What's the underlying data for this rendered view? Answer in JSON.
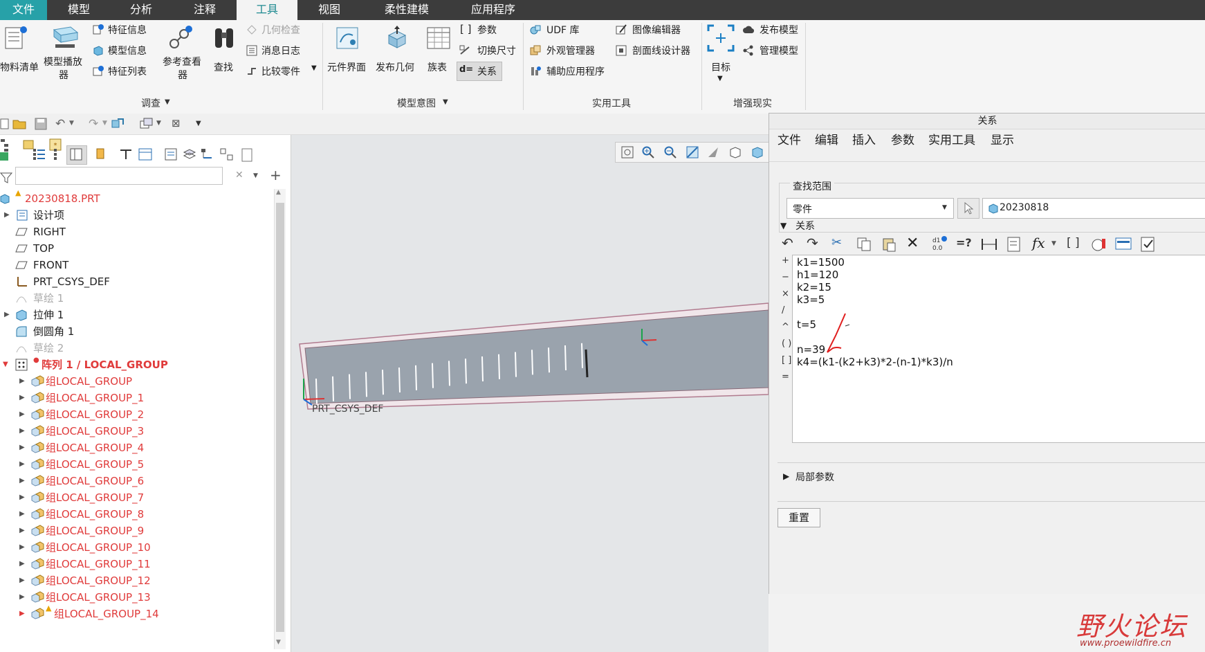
{
  "tabs": [
    "文件",
    "模型",
    "分析",
    "注释",
    "工具",
    "视图",
    "柔性建模",
    "应用程序"
  ],
  "active_tab": "工具",
  "ribbon": {
    "investigate": {
      "bom_label": "物料清单",
      "model_player_label1": "模型播放",
      "model_player_label2": "器",
      "feature_info": "特征信息",
      "model_info": "模型信息",
      "feature_list": "特征列表",
      "ref_viewer1": "参考查看",
      "ref_viewer2": "器",
      "find_label": "查找",
      "geom_check": "几何检查",
      "message_log": "消息日志",
      "compare_parts": "比较零件",
      "group_label": "调查"
    },
    "model_intent": {
      "component_interface": "元件界面",
      "publish_geom": "发布几何",
      "family_table": "族表",
      "parameters": "参数",
      "switch_dims": "切换尺寸",
      "relations": "关系",
      "group_label": "模型意图"
    },
    "utilities": {
      "udf_lib": "UDF 库",
      "appearance_mgr": "外观管理器",
      "aux_apps": "辅助应用程序",
      "image_editor": "图像编辑器",
      "section_designer": "剖面线设计器",
      "group_label": "实用工具"
    },
    "ar": {
      "targets": "目标",
      "publish_model": "发布模型",
      "manage_model": "管理模型",
      "group_label": "增强现实"
    }
  },
  "tree": {
    "search_placeholder": "",
    "root": "20230818.PRT",
    "items": [
      {
        "label": "设计项",
        "style": "normal"
      },
      {
        "label": "RIGHT",
        "style": "normal"
      },
      {
        "label": "TOP",
        "style": "normal"
      },
      {
        "label": "FRONT",
        "style": "normal"
      },
      {
        "label": "PRT_CSYS_DEF",
        "style": "normal"
      },
      {
        "label": "草绘 1",
        "style": "gray"
      },
      {
        "label": "拉伸 1",
        "style": "normal"
      },
      {
        "label": "倒圆角 1",
        "style": "normal"
      },
      {
        "label": "草绘 2",
        "style": "gray"
      }
    ],
    "pattern": "阵列 1 / LOCAL_GROUP",
    "groups": [
      "组LOCAL_GROUP",
      "组LOCAL_GROUP_1",
      "组LOCAL_GROUP_2",
      "组LOCAL_GROUP_3",
      "组LOCAL_GROUP_4",
      "组LOCAL_GROUP_5",
      "组LOCAL_GROUP_6",
      "组LOCAL_GROUP_7",
      "组LOCAL_GROUP_8",
      "组LOCAL_GROUP_9",
      "组LOCAL_GROUP_10",
      "组LOCAL_GROUP_11",
      "组LOCAL_GROUP_12",
      "组LOCAL_GROUP_13",
      "组LOCAL_GROUP_14"
    ]
  },
  "graphics": {
    "csys_label": "PRT_CSYS_DEF"
  },
  "dialog": {
    "title": "关系",
    "menu": [
      "文件",
      "编辑",
      "插入",
      "参数",
      "实用工具",
      "显示"
    ],
    "lookin_label": "查找范围",
    "lookin_value": "零件",
    "object_value": "20230818",
    "relations_label": "关系",
    "relations": [
      "k1=1500",
      "h1=120",
      "k2=15",
      "k3=5",
      "",
      "t=5",
      "",
      "n=39",
      "k4=(k1-(k2+k3)*2-(n-1)*k3)/n"
    ],
    "operators": [
      "+",
      "−",
      "×",
      "/",
      "^",
      "( )",
      "[ ]",
      "="
    ],
    "local_params": "局部参数",
    "reset_button": "重置"
  },
  "watermark": {
    "name": "野火论坛",
    "url": "www.proewildfire.cn"
  }
}
